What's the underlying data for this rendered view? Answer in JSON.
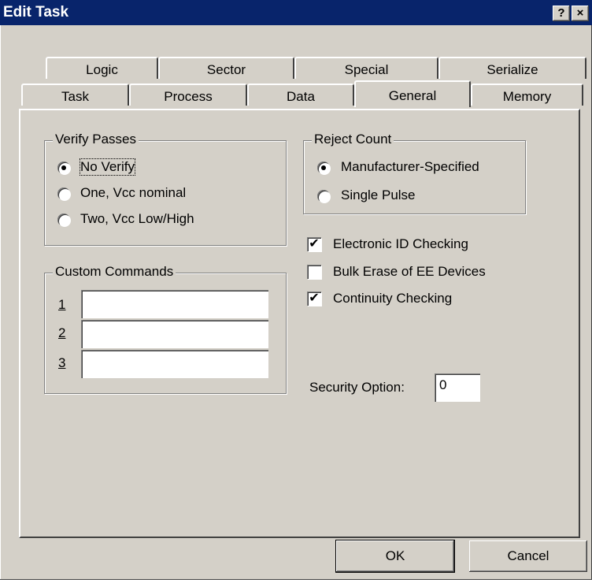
{
  "window": {
    "title": "Edit Task",
    "help_glyph": "?",
    "close_glyph": "×"
  },
  "tabs_back": [
    "Logic",
    "Sector",
    "Special",
    "Serialize"
  ],
  "tabs_front": [
    "Task",
    "Process",
    "Data",
    "General",
    "Memory"
  ],
  "active_tab": "General",
  "verify_passes": {
    "legend": "Verify Passes",
    "options": [
      "No Verify",
      "One, Vcc nominal",
      "Two, Vcc Low/High"
    ],
    "selected": "No Verify"
  },
  "reject_count": {
    "legend": "Reject Count",
    "options": [
      "Manufacturer-Specified",
      "Single Pulse"
    ],
    "selected": "Manufacturer-Specified"
  },
  "checks": [
    {
      "label": "Electronic ID Checking",
      "checked": true
    },
    {
      "label": "Bulk Erase of EE Devices",
      "checked": false
    },
    {
      "label": "Continuity Checking",
      "checked": true
    }
  ],
  "custom_commands": {
    "legend": "Custom Commands",
    "rows": [
      {
        "num": "1",
        "value": ""
      },
      {
        "num": "2",
        "value": ""
      },
      {
        "num": "3",
        "value": ""
      }
    ]
  },
  "security": {
    "label": "Security Option:",
    "value": "0"
  },
  "buttons": {
    "ok": "OK",
    "cancel": "Cancel"
  },
  "check_glyph": "✔"
}
